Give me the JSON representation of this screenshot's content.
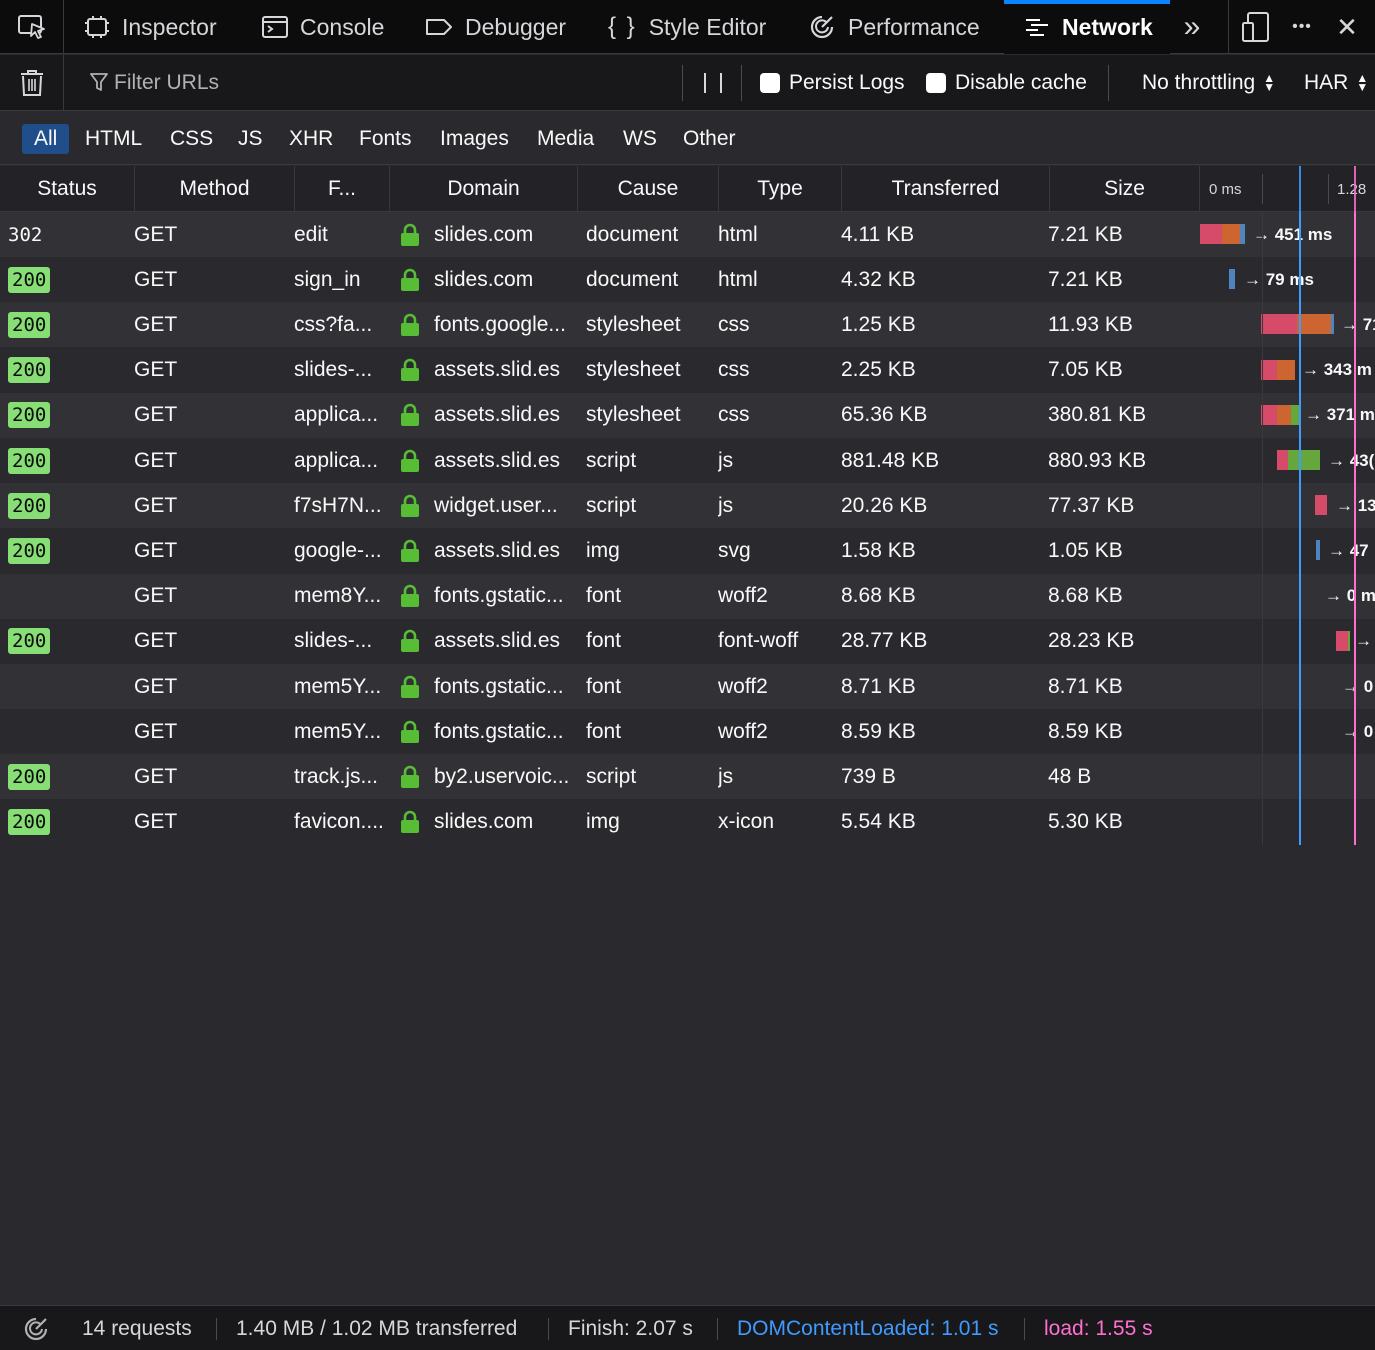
{
  "toolbox": {
    "tabs": [
      {
        "label": "Inspector",
        "icon": "inspector-icon"
      },
      {
        "label": "Console",
        "icon": "console-icon"
      },
      {
        "label": "Debugger",
        "icon": "debugger-icon"
      },
      {
        "label": "Style Editor",
        "icon": "style-editor-icon"
      },
      {
        "label": "Performance",
        "icon": "performance-icon"
      },
      {
        "label": "Network",
        "icon": "network-icon",
        "active": true
      }
    ],
    "more_tools_glyph": "»",
    "menu_glyph": "•••",
    "close_glyph": "✕"
  },
  "filterbar": {
    "filter_placeholder": "Filter URLs",
    "persist_logs_label": "Persist Logs",
    "disable_cache_label": "Disable cache",
    "throttling_value": "No throttling",
    "har_label": "HAR"
  },
  "type_filters": [
    "All",
    "HTML",
    "CSS",
    "JS",
    "XHR",
    "Fonts",
    "Images",
    "Media",
    "WS",
    "Other"
  ],
  "columns": {
    "status": "Status",
    "method": "Method",
    "file": "F...",
    "domain": "Domain",
    "cause": "Cause",
    "type": "Type",
    "transferred": "Transferred",
    "size": "Size",
    "waterfall_tick_0": "0 ms",
    "waterfall_tick_1": "1.28"
  },
  "requests": [
    {
      "status": "302",
      "method": "GET",
      "file": "edit",
      "domain": "slides.com",
      "cause": "document",
      "type": "html",
      "transferred": "4.11 KB",
      "size": "7.21 KB",
      "timing": "→ 451 ms"
    },
    {
      "status": "200",
      "method": "GET",
      "file": "sign_in",
      "domain": "slides.com",
      "cause": "document",
      "type": "html",
      "transferred": "4.32 KB",
      "size": "7.21 KB",
      "timing": "→ 79 ms"
    },
    {
      "status": "200",
      "method": "GET",
      "file": "css?fa...",
      "domain": "fonts.google...",
      "cause": "stylesheet",
      "type": "css",
      "transferred": "1.25 KB",
      "size": "11.93 KB",
      "timing": "→ 71"
    },
    {
      "status": "200",
      "method": "GET",
      "file": "slides-...",
      "domain": "assets.slid.es",
      "cause": "stylesheet",
      "type": "css",
      "transferred": "2.25 KB",
      "size": "7.05 KB",
      "timing": "→ 343 m"
    },
    {
      "status": "200",
      "method": "GET",
      "file": "applica...",
      "domain": "assets.slid.es",
      "cause": "stylesheet",
      "type": "css",
      "transferred": "65.36 KB",
      "size": "380.81 KB",
      "timing": "→ 371 m"
    },
    {
      "status": "200",
      "method": "GET",
      "file": "applica...",
      "domain": "assets.slid.es",
      "cause": "script",
      "type": "js",
      "transferred": "881.48 KB",
      "size": "880.93 KB",
      "timing": "→ 43("
    },
    {
      "status": "200",
      "method": "GET",
      "file": "f7sH7N...",
      "domain": "widget.user...",
      "cause": "script",
      "type": "js",
      "transferred": "20.26 KB",
      "size": "77.37 KB",
      "timing": "→ 13"
    },
    {
      "status": "200",
      "method": "GET",
      "file": "google-...",
      "domain": "assets.slid.es",
      "cause": "img",
      "type": "svg",
      "transferred": "1.58 KB",
      "size": "1.05 KB",
      "timing": "→ 47"
    },
    {
      "status": "",
      "method": "GET",
      "file": "mem8Y...",
      "domain": "fonts.gstatic...",
      "cause": "font",
      "type": "woff2",
      "transferred": "8.68 KB",
      "size": "8.68 KB",
      "timing": "→ 0 m"
    },
    {
      "status": "200",
      "method": "GET",
      "file": "slides-...",
      "domain": "assets.slid.es",
      "cause": "font",
      "type": "font-woff",
      "transferred": "28.77 KB",
      "size": "28.23 KB",
      "timing": "→"
    },
    {
      "status": "",
      "method": "GET",
      "file": "mem5Y...",
      "domain": "fonts.gstatic...",
      "cause": "font",
      "type": "woff2",
      "transferred": "8.71 KB",
      "size": "8.71 KB",
      "timing": "→ 0"
    },
    {
      "status": "",
      "method": "GET",
      "file": "mem5Y...",
      "domain": "fonts.gstatic...",
      "cause": "font",
      "type": "woff2",
      "transferred": "8.59 KB",
      "size": "8.59 KB",
      "timing": "→ 0"
    },
    {
      "status": "200",
      "method": "GET",
      "file": "track.js...",
      "domain": "by2.uservoic...",
      "cause": "script",
      "type": "js",
      "transferred": "739 B",
      "size": "48 B",
      "timing": ""
    },
    {
      "status": "200",
      "method": "GET",
      "file": "favicon....",
      "domain": "slides.com",
      "cause": "img",
      "type": "x-icon",
      "transferred": "5.54 KB",
      "size": "5.30 KB",
      "timing": ""
    }
  ],
  "summary": {
    "requests": "14 requests",
    "transferred": "1.40 MB / 1.02 MB transferred",
    "finish": "Finish: 2.07 s",
    "dom_content_loaded": "DOMContentLoaded: 1.01 s",
    "load": "load: 1.55 s"
  },
  "colors": {
    "accent": "#0a84ff",
    "status_ok_badge": "#86de74",
    "dom_content_loaded": "#3f9bff",
    "load": "#ff6fd0",
    "timing_blocked": "#d74b6a",
    "timing_wait": "#cd6530",
    "timing_receive": "#65a63d",
    "timing_dns": "#4d85c0"
  }
}
